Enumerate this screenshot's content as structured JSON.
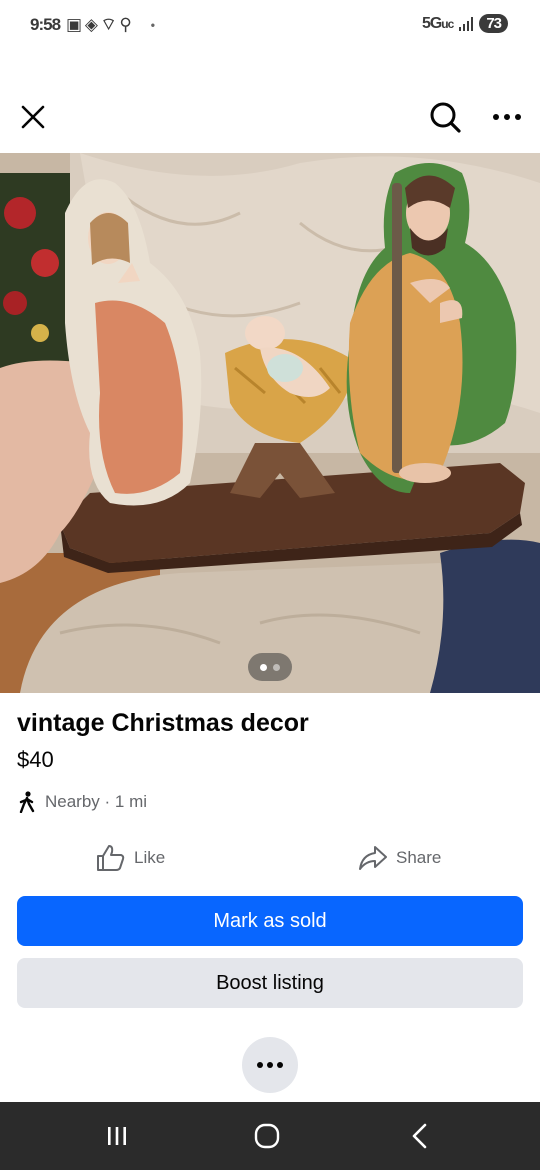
{
  "status_bar": {
    "time": "9:58",
    "network": "5G",
    "network_suffix": "uc",
    "battery": "73"
  },
  "top_nav": {
    "close_icon": "close-icon",
    "search_icon": "search-icon",
    "more_icon": "more-horizontal-icon"
  },
  "photo": {
    "page_count": 2,
    "current_page": 1
  },
  "listing": {
    "title": "vintage Christmas decor",
    "price": "$40",
    "location": "Nearby · 1 mi"
  },
  "actions": {
    "like_label": "Like",
    "share_label": "Share"
  },
  "buttons": {
    "mark_sold_label": "Mark as sold",
    "boost_label": "Boost listing"
  },
  "colors": {
    "primary": "#0866ff",
    "secondary_bg": "#e4e6eb",
    "muted_text": "#65676b"
  }
}
